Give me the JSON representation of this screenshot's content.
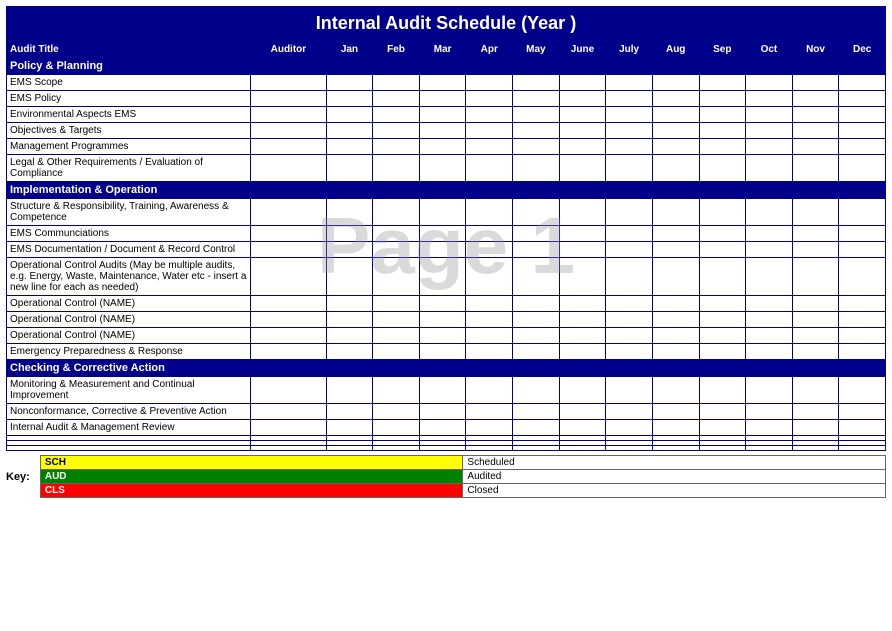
{
  "header": {
    "title": "Internal Audit Schedule (Year            )"
  },
  "columns": {
    "audit_title": "Audit Title",
    "auditor": "Auditor",
    "months": [
      "Jan",
      "Feb",
      "Mar",
      "Apr",
      "May",
      "June",
      "July",
      "Aug",
      "Sep",
      "Oct",
      "Nov",
      "Dec"
    ]
  },
  "sections": [
    {
      "name": "Policy & Planning",
      "rows": [
        {
          "title": "EMS Scope",
          "auditor": ""
        },
        {
          "title": "EMS Policy",
          "auditor": ""
        },
        {
          "title": "Environmental Aspects                        EMS",
          "auditor": ""
        },
        {
          "title": "Objectives & Targets",
          "auditor": ""
        },
        {
          "title": "Management Programmes",
          "auditor": ""
        },
        {
          "title": "Legal & Other Requirements / Evaluation of Compliance",
          "auditor": ""
        }
      ]
    },
    {
      "name": "Implementation & Operation",
      "rows": [
        {
          "title": "Structure & Responsibility, Training, Awareness & Competence",
          "auditor": ""
        },
        {
          "title": "EMS Communciations",
          "auditor": ""
        },
        {
          "title": "EMS Documentation / Document & Record Control",
          "auditor": ""
        },
        {
          "title": "Operational Control Audits (May be multiple audits, e.g. Energy, Waste, Maintenance, Water etc - insert a new line for each as needed)",
          "auditor": ""
        },
        {
          "title": "Operational Control (NAME)",
          "auditor": ""
        },
        {
          "title": "Operational Control (NAME)",
          "auditor": ""
        },
        {
          "title": "Operational Control (NAME)",
          "auditor": ""
        },
        {
          "title": "Emergency Preparedness & Response",
          "auditor": ""
        }
      ]
    },
    {
      "name": "Checking & Corrective Action",
      "rows": [
        {
          "title": "Monitoring & Measurement and Continual Improvement",
          "auditor": ""
        },
        {
          "title": "Nonconformance, Corrective & Preventive Action",
          "auditor": ""
        },
        {
          "title": "Internal Audit & Management Review",
          "auditor": ""
        }
      ]
    },
    {
      "name": "extra_rows",
      "rows": [
        {
          "title": "",
          "auditor": ""
        },
        {
          "title": "",
          "auditor": ""
        },
        {
          "title": "",
          "auditor": ""
        }
      ]
    }
  ],
  "key": {
    "label": "Key:",
    "items": [
      {
        "code": "SCH",
        "label": "Scheduled",
        "color": "#FFFF00",
        "text_color": "#000"
      },
      {
        "code": "AUD",
        "label": "Audited",
        "color": "#008000",
        "text_color": "#fff"
      },
      {
        "code": "CLS",
        "label": "Closed",
        "color": "#FF0000",
        "text_color": "#fff"
      }
    ]
  },
  "watermark": "Page 1"
}
